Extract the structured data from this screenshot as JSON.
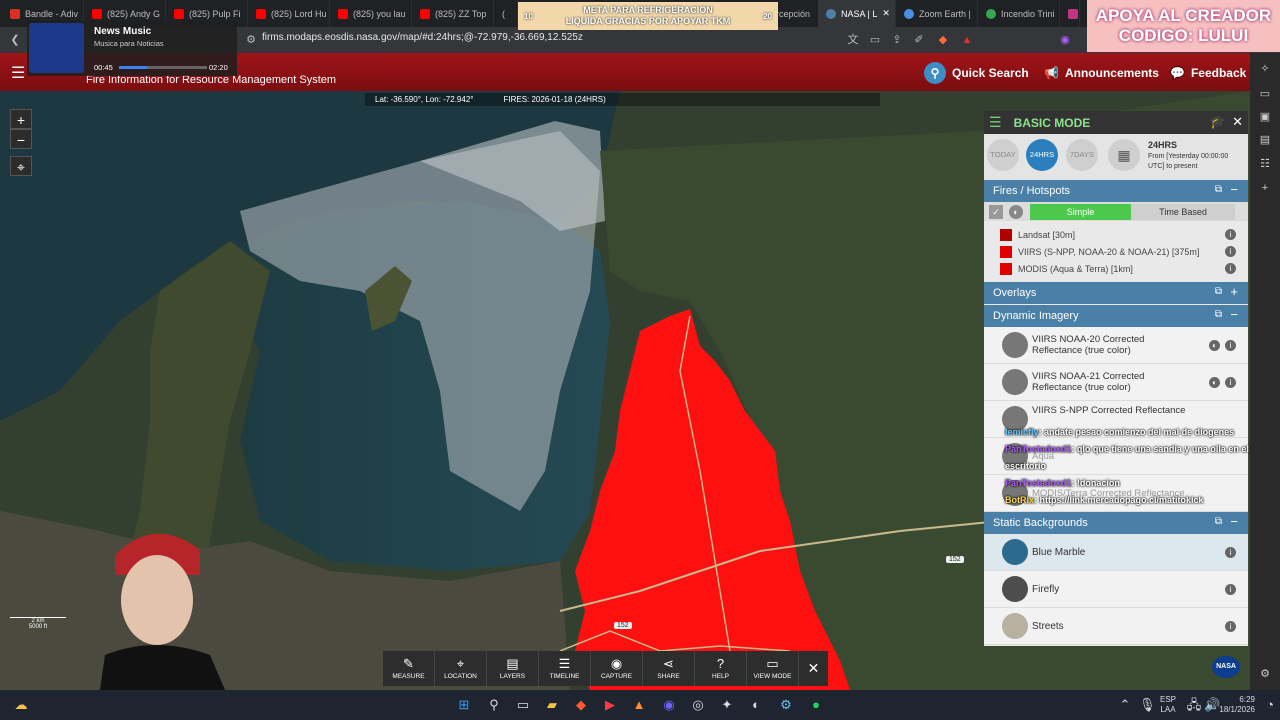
{
  "browser": {
    "tabs": [
      {
        "label": "Bandle - Adiv",
        "color": "#d93025"
      },
      {
        "label": "(825) Andy G",
        "color": "#ff0000"
      },
      {
        "label": "(825) Pulp Fi",
        "color": "#ff0000"
      },
      {
        "label": "(825) Lord Hu",
        "color": "#ff0000"
      },
      {
        "label": "(825) you lau",
        "color": "#ff0000"
      },
      {
        "label": "(825) ZZ Top",
        "color": "#ff0000"
      },
      {
        "label": "(",
        "color": "#ff0000"
      },
      {
        "label": "Percepción",
        "color": "#8a8a8a"
      },
      {
        "label": "NASA | L",
        "color": "#4a7fa7"
      },
      {
        "label": "Zoom Earth |",
        "color": "#4a90e2"
      },
      {
        "label": "Incendio Trini",
        "color": "#34a853"
      },
      {
        "label": "(",
        "color": "#c13584"
      }
    ],
    "url": "firms.modaps.eosdis.nasa.gov/map/#d:24hrs;@-72.979,-36.669,12.525z"
  },
  "header": {
    "title": "Fire Information for Resource Management System",
    "quick_search": "Quick Search",
    "announcements": "Announcements",
    "feedback": "Feedback"
  },
  "map": {
    "coords": "Lat: -36.590°, Lon: -72.942°",
    "fires": "FIRES: 2026-01-18 (24HRS)",
    "road_label": "152",
    "scale_km": "2 km",
    "scale_ft": "5000 ft"
  },
  "panel": {
    "mode": "BASIC MODE",
    "time_buttons": [
      "TODAY",
      "24HRS",
      "7DAYS"
    ],
    "time_title": "24HRS",
    "time_desc": "From [Yesterday 00:00:00 UTC] to present",
    "fires_section": "Fires / Hotspots",
    "simple": "Simple",
    "time_based": "Time Based",
    "fire_layers": [
      {
        "label": "Landsat [30m]",
        "color": "#b00000"
      },
      {
        "label": "VIIRS (S-NPP, NOAA-20 & NOAA-21) [375m]",
        "color": "#e00000"
      },
      {
        "label": "MODIS (Aqua & Terra) [1km]",
        "color": "#e00000"
      }
    ],
    "overlays": "Overlays",
    "dynamic_section": "Dynamic Imagery",
    "dynamic_layers": [
      {
        "label": "VIIRS NOAA-20 Corrected Reflectance (true color)"
      },
      {
        "label": "VIIRS NOAA-21 Corrected Reflectance (true color)"
      },
      {
        "label": "VIIRS S-NPP Corrected Reflectance"
      },
      {
        "label": "Aqua"
      },
      {
        "label": "MODIS/Terra Corrected Reflectance"
      }
    ],
    "static_section": "Static Backgrounds",
    "backgrounds": [
      {
        "label": "Blue Marble",
        "color": "#2d6a8f"
      },
      {
        "label": "Firefly",
        "color": "#4d4d4d"
      },
      {
        "label": "Streets",
        "color": "#b8b0a0"
      }
    ]
  },
  "toolbar": [
    {
      "label": "MEASURE",
      "icon": "ruler-icon",
      "glyph": "✎"
    },
    {
      "label": "LOCATION",
      "icon": "pin-icon",
      "glyph": "⌖"
    },
    {
      "label": "LAYERS",
      "icon": "layers-icon",
      "glyph": "▤"
    },
    {
      "label": "TIMELINE",
      "icon": "sliders-icon",
      "glyph": "☰"
    },
    {
      "label": "CAPTURE",
      "icon": "camera-icon",
      "glyph": "◉"
    },
    {
      "label": "SHARE",
      "icon": "share-icon",
      "glyph": "⋖"
    },
    {
      "label": "HELP",
      "icon": "help-icon",
      "glyph": "?"
    },
    {
      "label": "VIEW MODE",
      "icon": "monitor-icon",
      "glyph": "▭"
    }
  ],
  "overlays": {
    "music_title": "News Music",
    "music_sub": "Musica para Noticias",
    "music_time_start": "00:45",
    "music_time_end": "02:20",
    "meta_line1": "META PARA REFRIGERACION",
    "meta_line2": "LIQUIDA GRACIAS POR APOYAR TKM",
    "meta_left": "10",
    "meta_right": "20",
    "donate_line1": "APOYA AL CREADOR",
    "donate_line2": "CODIGO: LULUI",
    "chat": [
      {
        "user": "lemicfly",
        "msg": ": andate pesao comienzo del mal de diogenes",
        "color": "#5cc8ff"
      },
      {
        "user": "PanTostadoxd1",
        "msg": ": qlo que tiene una sandia y una olla en el escritorio",
        "color": "#b05cff"
      },
      {
        "user": "PanTostadoxd1",
        "msg": ": !donacion",
        "color": "#b05cff"
      },
      {
        "user": "BotRix",
        "msg": ": https://link.mercadopago.cl/matitokick",
        "color": "#ffd84a"
      }
    ]
  },
  "taskbar": {
    "lang1": "ESP",
    "lang2": "LAA",
    "time": "6:29",
    "date": "18/1/2026"
  }
}
